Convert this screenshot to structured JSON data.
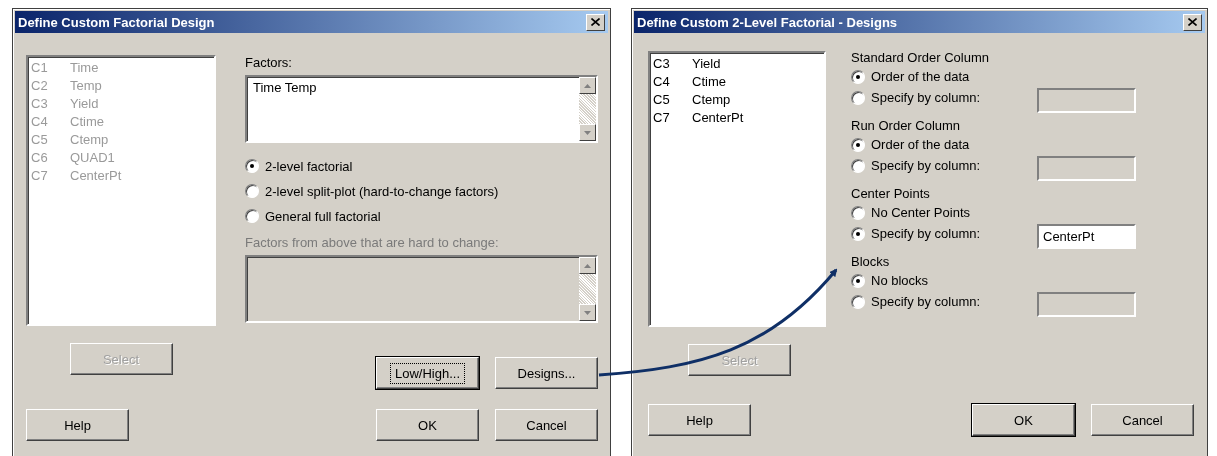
{
  "main_dialog": {
    "title": "Define Custom Factorial Design",
    "column_list": {
      "disabled": true,
      "items": [
        {
          "code": "C1",
          "name": "Time"
        },
        {
          "code": "C2",
          "name": "Temp"
        },
        {
          "code": "C3",
          "name": "Yield"
        },
        {
          "code": "C4",
          "name": "Ctime"
        },
        {
          "code": "C5",
          "name": "Ctemp"
        },
        {
          "code": "C6",
          "name": "QUAD1"
        },
        {
          "code": "C7",
          "name": "CenterPt"
        }
      ]
    },
    "factors": {
      "label": "Factors:",
      "value": "Time Temp"
    },
    "design_types": [
      {
        "label": "2-level factorial",
        "selected": true
      },
      {
        "label": "2-level split-plot (hard-to-change factors)",
        "selected": false
      },
      {
        "label": "General full factorial",
        "selected": false
      }
    ],
    "hard_to_change": {
      "label": "Factors from above that are hard to change:",
      "disabled": true
    },
    "select_button": {
      "label": "Select",
      "disabled": true
    },
    "option_buttons": [
      {
        "label": "Low/High...",
        "focused": true
      },
      {
        "label": "Designs...",
        "focused": false
      }
    ],
    "footer_buttons": [
      {
        "kind": "help",
        "label": "Help",
        "default": false
      },
      {
        "kind": "ok",
        "label": "OK",
        "default": false
      },
      {
        "kind": "cancel",
        "label": "Cancel",
        "default": false
      }
    ]
  },
  "designs_dialog": {
    "title": "Define Custom 2-Level Factorial - Designs",
    "column_list": {
      "disabled": false,
      "items": [
        {
          "code": "C3",
          "name": "Yield"
        },
        {
          "code": "C4",
          "name": "Ctime"
        },
        {
          "code": "C5",
          "name": "Ctemp"
        },
        {
          "code": "C7",
          "name": "CenterPt"
        }
      ]
    },
    "groups": [
      {
        "label": "Standard Order Column",
        "options": [
          {
            "kind": "choice",
            "label": "Order of the data",
            "selected": true
          },
          {
            "kind": "column",
            "label": "Specify by column:",
            "selected": false
          }
        ]
      },
      {
        "label": "Run Order Column",
        "options": [
          {
            "kind": "choice",
            "label": "Order of the data",
            "selected": true
          },
          {
            "kind": "column",
            "label": "Specify by column:",
            "selected": false
          }
        ]
      },
      {
        "label": "Center Points",
        "options": [
          {
            "kind": "choice",
            "label": "No Center Points",
            "selected": false
          },
          {
            "kind": "column",
            "label": "Specify by column:",
            "selected": true,
            "value": "CenterPt"
          }
        ]
      },
      {
        "label": "Blocks",
        "options": [
          {
            "kind": "choice",
            "label": "No blocks",
            "selected": true
          },
          {
            "kind": "column",
            "label": "Specify by column:",
            "selected": false
          }
        ]
      }
    ],
    "select_button": {
      "label": "Select",
      "disabled": true
    },
    "footer_buttons": [
      {
        "kind": "help",
        "label": "Help",
        "default": false
      },
      {
        "kind": "ok",
        "label": "OK",
        "default": true
      },
      {
        "kind": "cancel",
        "label": "Cancel",
        "default": false
      }
    ]
  }
}
